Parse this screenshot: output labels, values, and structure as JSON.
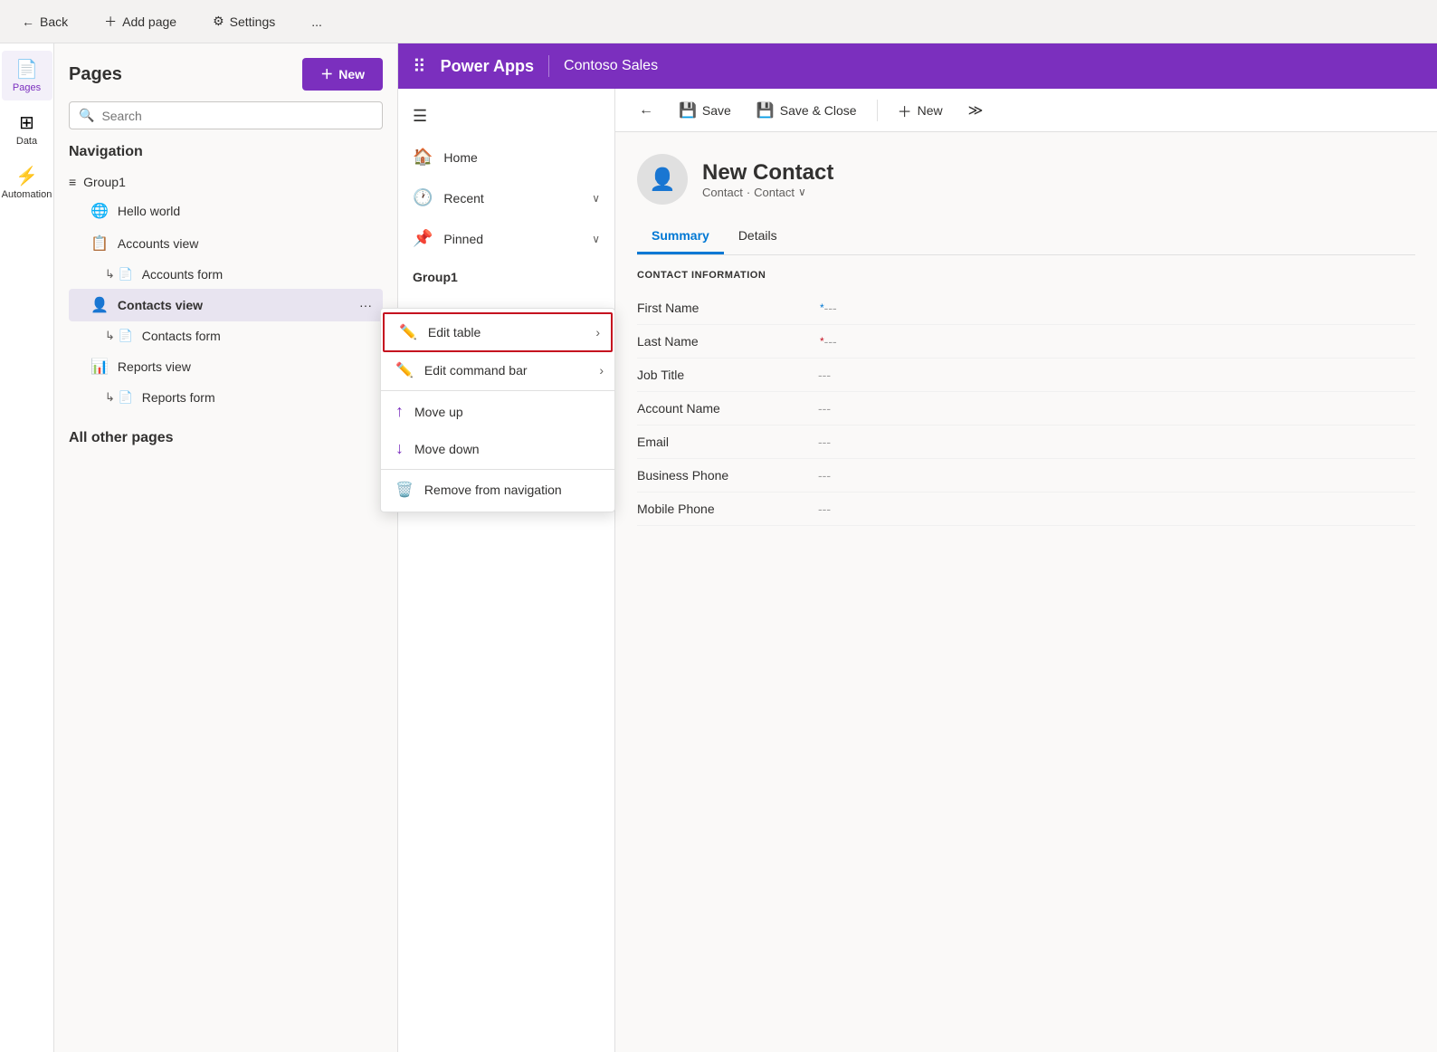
{
  "topbar": {
    "back_label": "Back",
    "add_page_label": "Add page",
    "settings_label": "Settings",
    "more_label": "..."
  },
  "icon_sidebar": {
    "items": [
      {
        "id": "pages",
        "label": "Pages",
        "icon": "📄",
        "active": true
      },
      {
        "id": "data",
        "label": "Data",
        "icon": "⊞",
        "active": false
      },
      {
        "id": "automation",
        "label": "Automation",
        "icon": "⚡",
        "active": false
      }
    ]
  },
  "pages_panel": {
    "title": "Pages",
    "new_button": "New",
    "search_placeholder": "Search",
    "navigation_title": "Navigation",
    "group1_label": "Group1",
    "nav_items": [
      {
        "id": "hello-world",
        "label": "Hello world",
        "icon": "🌐",
        "indent": 1
      },
      {
        "id": "accounts-view",
        "label": "Accounts view",
        "icon": "📋",
        "indent": 1
      },
      {
        "id": "accounts-form",
        "label": "Accounts form",
        "icon": "📄",
        "indent": 2
      },
      {
        "id": "contacts-view",
        "label": "Contacts view",
        "icon": "👤",
        "indent": 1,
        "active": true
      },
      {
        "id": "contacts-form",
        "label": "Contacts form",
        "icon": "📄",
        "indent": 2
      },
      {
        "id": "reports-view",
        "label": "Reports view",
        "icon": "📊",
        "indent": 1
      },
      {
        "id": "reports-form",
        "label": "Reports form",
        "icon": "📄",
        "indent": 2
      }
    ],
    "all_other_pages_title": "All other pages"
  },
  "context_menu": {
    "items": [
      {
        "id": "edit-table",
        "label": "Edit table",
        "icon": "✏️",
        "has_arrow": true,
        "highlighted": true
      },
      {
        "id": "edit-command-bar",
        "label": "Edit command bar",
        "icon": "✏️",
        "has_arrow": true
      },
      {
        "id": "move-up",
        "label": "Move up",
        "icon": "↑",
        "has_arrow": false
      },
      {
        "id": "move-down",
        "label": "Move down",
        "icon": "↓",
        "has_arrow": false
      },
      {
        "id": "remove-from-nav",
        "label": "Remove from navigation",
        "icon": "🗑️",
        "has_arrow": false
      }
    ]
  },
  "power_apps_bar": {
    "app_name": "Power Apps",
    "site_title": "Contoso Sales"
  },
  "app_nav": {
    "items": [
      {
        "id": "home",
        "label": "Home",
        "icon": "🏠"
      },
      {
        "id": "recent",
        "label": "Recent",
        "icon": "🕐",
        "has_chevron": true
      },
      {
        "id": "pinned",
        "label": "Pinned",
        "icon": "📌",
        "has_chevron": true
      }
    ],
    "group1_label": "Group1"
  },
  "toolbar": {
    "back_icon": "←",
    "save_label": "Save",
    "save_close_label": "Save & Close",
    "new_label": "New",
    "more_icon": "≫"
  },
  "contact": {
    "name": "New Contact",
    "sub1": "Contact",
    "sub2": "Contact",
    "tabs": [
      {
        "id": "summary",
        "label": "Summary",
        "active": true
      },
      {
        "id": "details",
        "label": "Details",
        "active": false
      }
    ],
    "section_title": "CONTACT INFORMATION",
    "fields": [
      {
        "id": "first-name",
        "label": "First Name",
        "value": "---",
        "required": true,
        "req_color": "blue"
      },
      {
        "id": "last-name",
        "label": "Last Name",
        "value": "---",
        "required": true,
        "req_color": "red"
      },
      {
        "id": "job-title",
        "label": "Job Title",
        "value": "---",
        "required": false
      },
      {
        "id": "account-name",
        "label": "Account Name",
        "value": "---",
        "required": false
      },
      {
        "id": "email",
        "label": "Email",
        "value": "---",
        "required": false
      },
      {
        "id": "business-phone",
        "label": "Business Phone",
        "value": "---",
        "required": false
      },
      {
        "id": "mobile-phone",
        "label": "Mobile Phone",
        "value": "---",
        "required": false
      }
    ]
  },
  "colors": {
    "purple": "#7b2fbe",
    "blue": "#0078d4",
    "red": "#c50f1f"
  }
}
